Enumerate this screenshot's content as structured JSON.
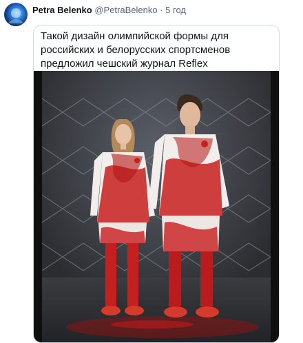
{
  "tweet": {
    "author_name": "Petra Belenko",
    "author_handle": "@PetraBelenko",
    "separator": "·",
    "timestamp": "5 год",
    "card_text": "Такой дизайн олимпийской формы для российских и белорусских спортсменов предложил чешский журнал Reflex"
  },
  "colors": {
    "text_primary": "#0f1419",
    "text_secondary": "#536471",
    "card_border": "#cfd9de",
    "uniform_white": "#f2eeec",
    "uniform_red": "#c81e1e"
  }
}
